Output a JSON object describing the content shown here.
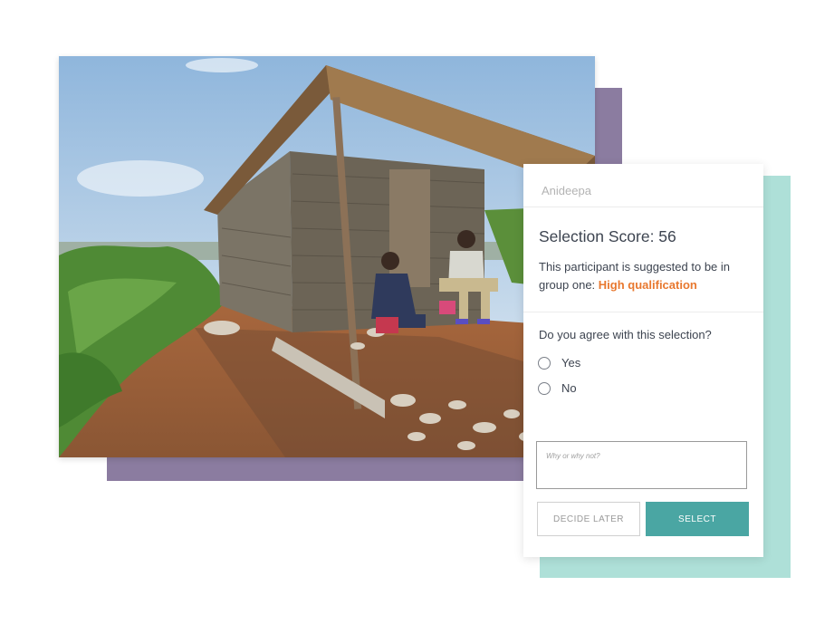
{
  "card": {
    "participant_name": "Anideepa",
    "score_label": "Selection Score: 56",
    "description_prefix": "This participant is suggested to be in group one: ",
    "description_highlight": "High qualification",
    "question": "Do you agree with this selection?",
    "options": [
      "Yes",
      "No"
    ],
    "comment_placeholder": "Why or why not?",
    "decide_later_label": "DECIDE LATER",
    "select_label": "SELECT"
  },
  "colors": {
    "accent_purple": "#8b7ca0",
    "accent_teal": "#aee0d8",
    "highlight_orange": "#e8782f",
    "select_button": "#4aa6a3"
  }
}
